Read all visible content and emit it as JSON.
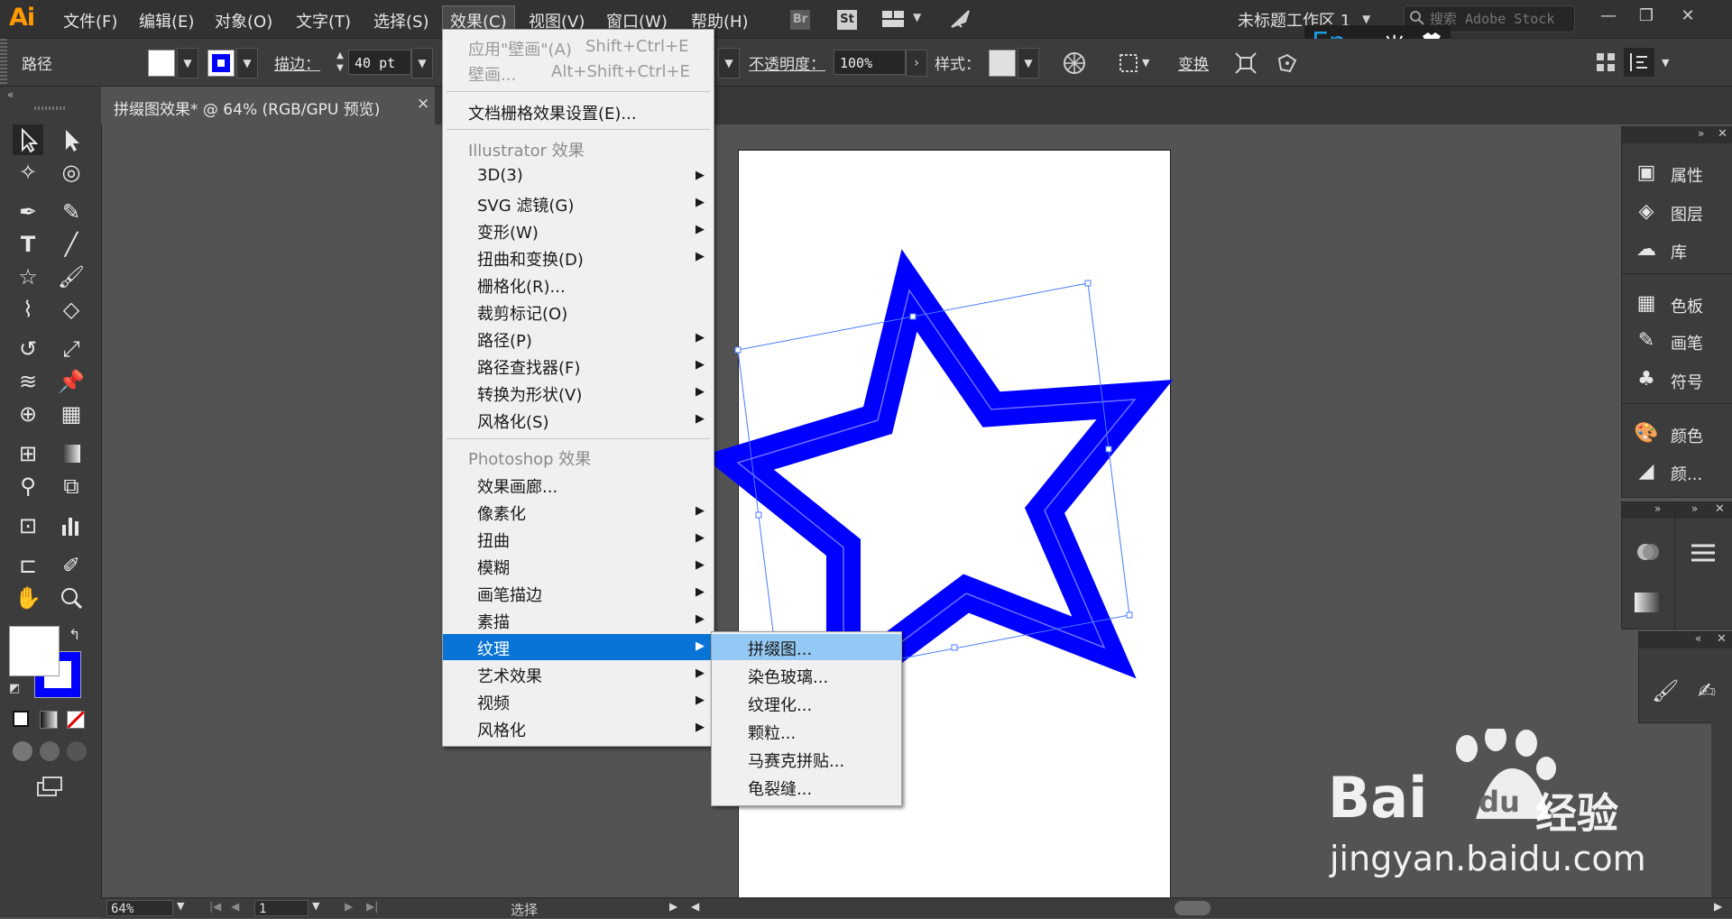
{
  "app": {
    "logo": "Ai"
  },
  "menubar": {
    "items": [
      {
        "label": "文件(F)"
      },
      {
        "label": "编辑(E)"
      },
      {
        "label": "对象(O)"
      },
      {
        "label": "文字(T)"
      },
      {
        "label": "选择(S)"
      },
      {
        "label": "效果(C)"
      },
      {
        "label": "视图(V)"
      },
      {
        "label": "窗口(W)"
      },
      {
        "label": "帮助(H)"
      }
    ],
    "bridge": "Br",
    "stock": "St",
    "workspace": "未标题工作区 1",
    "search_placeholder": "搜索 Adobe Stock"
  },
  "ime": {
    "en": "En",
    "rest": "·, 半"
  },
  "control_bar": {
    "object_type": "路径",
    "stroke_label": "描边：",
    "stroke_value": "40 pt",
    "opacity_label": "不透明度：",
    "opacity_value": "100%",
    "style_label": "样式：",
    "transform_label": "变换",
    "fill_color": "#ffffff",
    "stroke_color": "#0000ff"
  },
  "document": {
    "tab_title": "拼缀图效果* @ 64% (RGB/GPU 预览)",
    "close": "×"
  },
  "effect_menu": {
    "apply_last": "应用\"壁画\"(A)",
    "apply_last_shortcut": "Shift+Ctrl+E",
    "last_effect": "壁画...",
    "last_effect_shortcut": "Alt+Shift+Ctrl+E",
    "raster_settings": "文档栅格效果设置(E)...",
    "illustrator_header": "Illustrator 效果",
    "illustrator_items": [
      {
        "label": "3D(3)",
        "sub": true
      },
      {
        "label": "SVG 滤镜(G)",
        "sub": true
      },
      {
        "label": "变形(W)",
        "sub": true
      },
      {
        "label": "扭曲和变换(D)",
        "sub": true
      },
      {
        "label": "栅格化(R)...",
        "sub": false
      },
      {
        "label": "裁剪标记(O)",
        "sub": false
      },
      {
        "label": "路径(P)",
        "sub": true
      },
      {
        "label": "路径查找器(F)",
        "sub": true
      },
      {
        "label": "转换为形状(V)",
        "sub": true
      },
      {
        "label": "风格化(S)",
        "sub": true
      }
    ],
    "photoshop_header": "Photoshop 效果",
    "photoshop_items": [
      {
        "label": "效果画廊...",
        "sub": false
      },
      {
        "label": "像素化",
        "sub": true
      },
      {
        "label": "扭曲",
        "sub": true
      },
      {
        "label": "模糊",
        "sub": true
      },
      {
        "label": "画笔描边",
        "sub": true
      },
      {
        "label": "素描",
        "sub": true
      },
      {
        "label": "纹理",
        "sub": true
      },
      {
        "label": "艺术效果",
        "sub": true
      },
      {
        "label": "视频",
        "sub": true
      },
      {
        "label": "风格化",
        "sub": true
      }
    ]
  },
  "texture_submenu": {
    "items": [
      {
        "label": "拼缀图..."
      },
      {
        "label": "染色玻璃..."
      },
      {
        "label": "纹理化..."
      },
      {
        "label": "颗粒..."
      },
      {
        "label": "马赛克拼贴..."
      },
      {
        "label": "龟裂缝..."
      }
    ]
  },
  "panels": {
    "group1": [
      {
        "label": "属性"
      },
      {
        "label": "图层"
      },
      {
        "label": "库"
      }
    ],
    "group2": [
      {
        "label": "色板"
      },
      {
        "label": "画笔"
      },
      {
        "label": "符号"
      }
    ],
    "group3": [
      {
        "label": "颜色"
      },
      {
        "label": "颜..."
      }
    ]
  },
  "status_bar": {
    "zoom": "64%",
    "artboard": "1",
    "mode": "选择"
  },
  "watermark": {
    "brand": "Bai",
    "brand2": "经验",
    "url": "jingyan.baidu.com"
  }
}
